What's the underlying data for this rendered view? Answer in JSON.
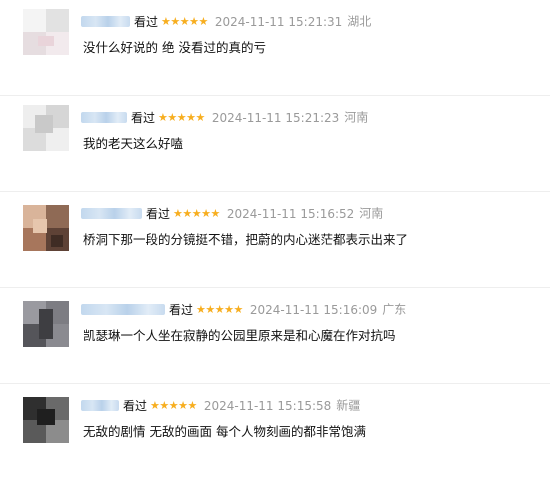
{
  "comments": [
    {
      "status": "看过",
      "stars": "★★★★★",
      "time": "2024-11-11 15:21:31",
      "location": "湖北",
      "text": "没什么好说的 绝 没看过的真的亏"
    },
    {
      "status": "看过",
      "stars": "★★★★★",
      "time": "2024-11-11 15:21:23",
      "location": "河南",
      "text": "我的老天这么好嗑"
    },
    {
      "status": "看过",
      "stars": "★★★★★",
      "time": "2024-11-11 15:16:52",
      "location": "河南",
      "text": "桥洞下那一段的分镜挺不错，把蔚的内心迷茫都表示出来了"
    },
    {
      "status": "看过",
      "stars": "★★★★★",
      "time": "2024-11-11 15:16:09",
      "location": "广东",
      "text": "凯瑟琳一个人坐在寂静的公园里原来是和心魔在作对抗吗"
    },
    {
      "status": "看过",
      "stars": "★★★★★",
      "time": "2024-11-11 15:15:58",
      "location": "新疆",
      "text": "无敌的剧情 无敌的画面 每个人物刻画的都非常饱满"
    }
  ]
}
